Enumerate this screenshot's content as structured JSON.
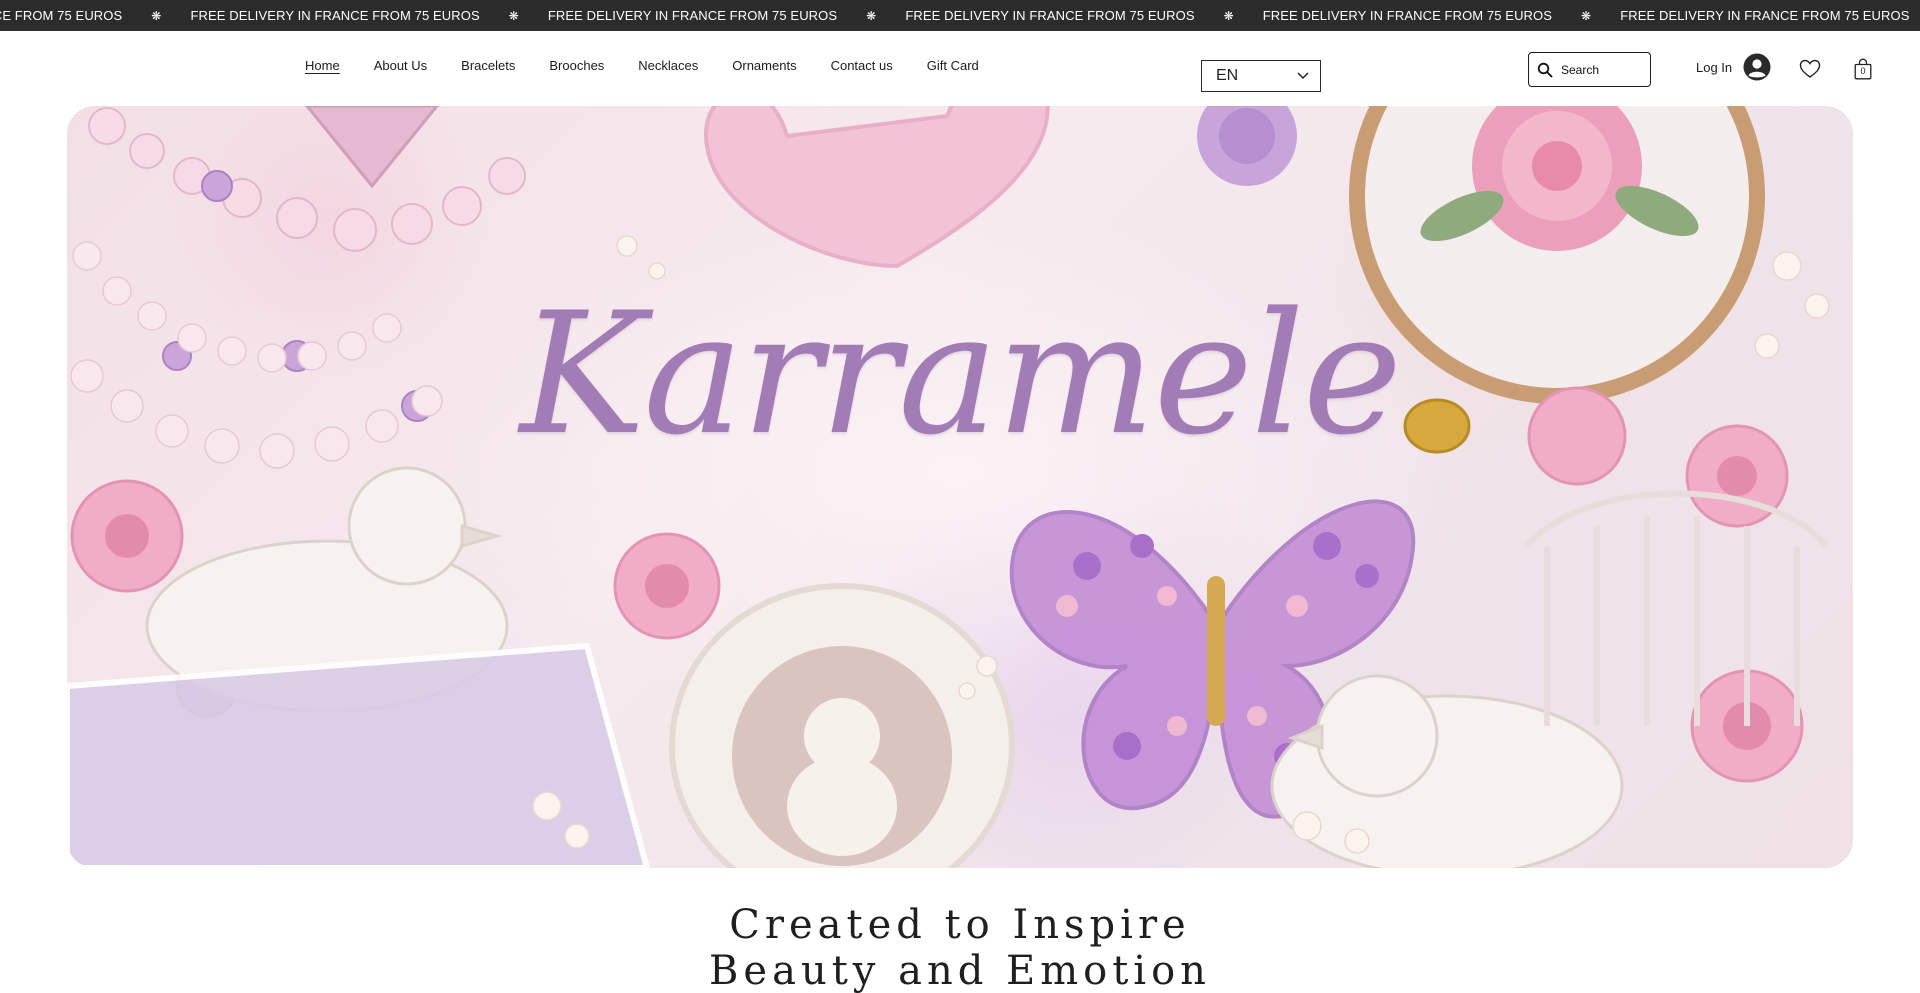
{
  "announcement": {
    "text": "FREE DELIVERY IN FRANCE FROM 75 EUROS",
    "separator": "❋",
    "repeat": 7
  },
  "nav": {
    "items": [
      {
        "label": "Home",
        "active": true
      },
      {
        "label": "About Us"
      },
      {
        "label": "Bracelets"
      },
      {
        "label": "Brooches"
      },
      {
        "label": "Necklaces"
      },
      {
        "label": "Ornaments"
      },
      {
        "label": "Contact us"
      },
      {
        "label": "Gift Card"
      }
    ]
  },
  "language": {
    "selected": "EN",
    "icon": "chevron-down-icon"
  },
  "search": {
    "placeholder": "Search",
    "icon": "search-icon"
  },
  "account": {
    "login_label": "Log In",
    "icon": "avatar-icon"
  },
  "wishlist": {
    "icon": "heart-icon"
  },
  "cart": {
    "count": "0",
    "icon": "shopping-bag-icon"
  },
  "hero": {
    "brand_text": "Karramele"
  },
  "tagline": {
    "line1": "Created to Inspire",
    "line2": "Beauty and Emotion"
  },
  "colors": {
    "announcement_bg": "#2c2c2c",
    "brand_purple": "#a27db5",
    "text_dark": "#1c1c1c"
  }
}
